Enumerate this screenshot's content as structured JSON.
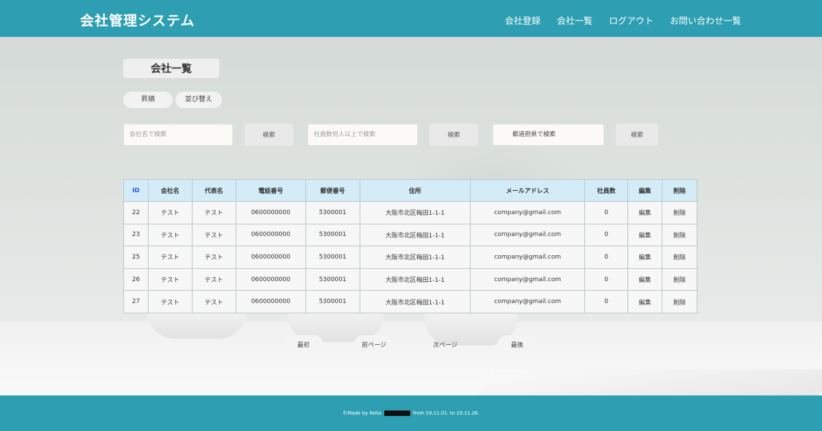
{
  "header": {
    "brand": "会社管理システム",
    "nav": [
      "会社登録",
      "会社一覧",
      "ログアウト",
      "お問い合わせ一覧"
    ]
  },
  "main": {
    "title": "会社一覧",
    "sort": {
      "asc_label": "昇順",
      "order_label": "並び替え"
    },
    "search": {
      "company_placeholder": "会社名で検索",
      "employees_placeholder": "社員数何人以上で検索",
      "prefecture_label": "都道府県で検索",
      "button_label": "検索"
    },
    "table": {
      "headers": [
        "ID",
        "会社名",
        "代表名",
        "電話番号",
        "郵便番号",
        "住所",
        "メールアドレス",
        "社員数",
        "編集",
        "削除"
      ],
      "rows": [
        {
          "id": "22",
          "company": "テスト",
          "rep": "テスト",
          "phone": "0600000000",
          "zip": "5300001",
          "address": "大阪市北区梅田1-1-1",
          "email": "company@gmail.com",
          "employees": "0",
          "edit": "編集",
          "delete": "削除"
        },
        {
          "id": "23",
          "company": "テスト",
          "rep": "テスト",
          "phone": "0600000000",
          "zip": "5300001",
          "address": "大阪市北区梅田1-1-1",
          "email": "company@gmail.com",
          "employees": "0",
          "edit": "編集",
          "delete": "削除"
        },
        {
          "id": "25",
          "company": "テスト",
          "rep": "テスト",
          "phone": "0600000000",
          "zip": "5300001",
          "address": "大阪市北区梅田1-1-1",
          "email": "company@gmail.com",
          "employees": "0",
          "edit": "編集",
          "delete": "削除"
        },
        {
          "id": "26",
          "company": "テスト",
          "rep": "テスト",
          "phone": "0600000000",
          "zip": "5300001",
          "address": "大阪市北区梅田1-1-1",
          "email": "company@gmail.com",
          "employees": "0",
          "edit": "編集",
          "delete": "削除"
        },
        {
          "id": "27",
          "company": "テスト",
          "rep": "テスト",
          "phone": "0600000000",
          "zip": "5300001",
          "address": "大阪市北区梅田1-1-1",
          "email": "company@gmail.com",
          "employees": "0",
          "edit": "編集",
          "delete": "削除"
        }
      ]
    },
    "pager": {
      "first": "最初",
      "prev": "前ページ",
      "next": "次ページ",
      "last": "最後"
    }
  },
  "footer": {
    "prefix": "©Made by Keita",
    "suffix": "from 19.11.01. to 19.11.26."
  },
  "colors": {
    "header_bg": "#2e9fb2",
    "table_header_bg": "#d4ecf8",
    "link": "#2a5bd8"
  }
}
